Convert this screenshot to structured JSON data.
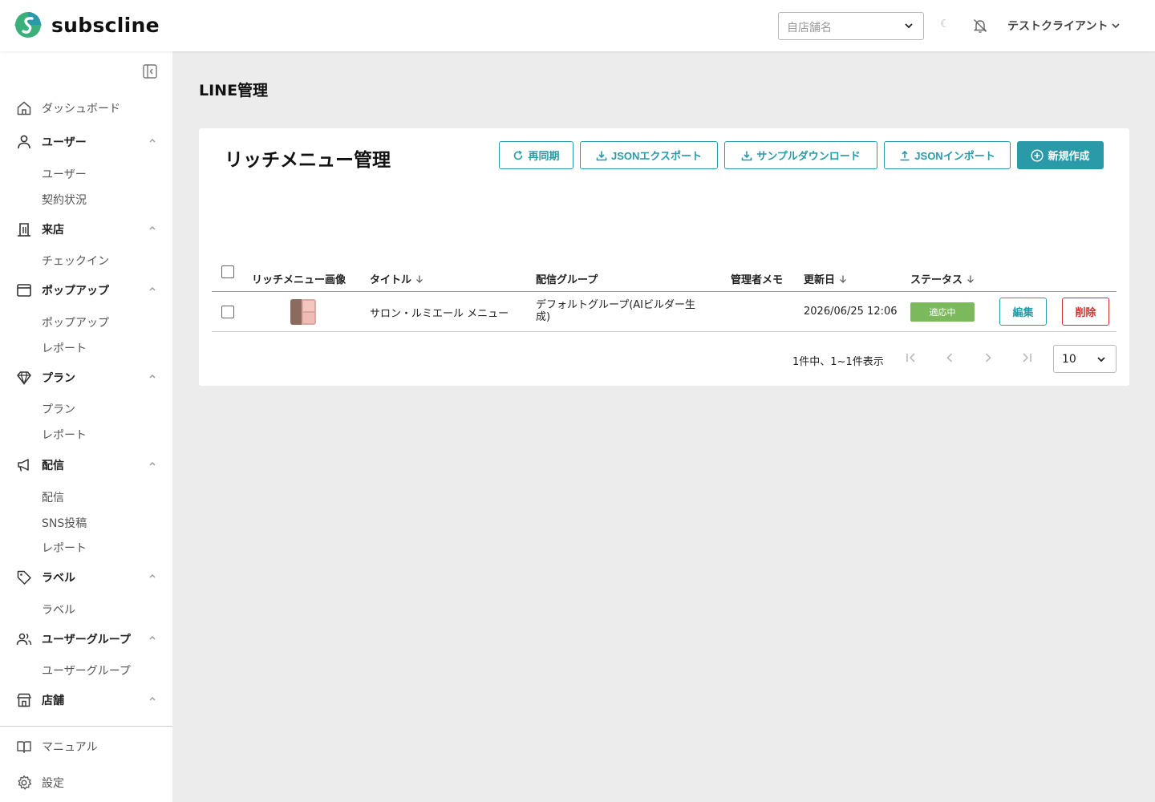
{
  "app": {
    "brand": "subscline",
    "colors": {
      "accent": "#2a9aa8",
      "danger": "#d0302c",
      "status_active": "#7cb95c",
      "logo_green": "#3ab07a",
      "logo_teal": "#2a9aa8"
    }
  },
  "header": {
    "store_placeholder": "自店舗名",
    "theme_icon": "☾",
    "user_name": "テストクライアント"
  },
  "sidebar": {
    "groups": [
      {
        "label": "ダッシュボード",
        "icon": "home-icon",
        "items": []
      },
      {
        "label": "ユーザー",
        "icon": "user-icon",
        "items": [
          "ユーザー",
          "契約状況"
        ]
      },
      {
        "label": "来店",
        "icon": "building-icon",
        "items": [
          "チェックイン"
        ]
      },
      {
        "label": "ポップアップ",
        "icon": "window-icon",
        "items": [
          "ポップアップ",
          "レポート"
        ]
      },
      {
        "label": "プラン",
        "icon": "diamond-icon",
        "items": [
          "プラン",
          "レポート"
        ]
      },
      {
        "label": "配信",
        "icon": "megaphone-icon",
        "items": [
          "配信",
          "SNS投稿",
          "レポート"
        ]
      },
      {
        "label": "ラベル",
        "icon": "tag-icon",
        "items": [
          "ラベル"
        ]
      },
      {
        "label": "ユーザーグループ",
        "icon": "users-icon",
        "items": [
          "ユーザーグループ"
        ]
      },
      {
        "label": "店舗",
        "icon": "store-icon",
        "items": []
      }
    ],
    "footer": [
      {
        "label": "マニュアル",
        "icon": "book-icon"
      },
      {
        "label": "設定",
        "icon": "gear-icon"
      }
    ]
  },
  "page": {
    "title": "LINE管理",
    "card_title": "リッチメニュー管理",
    "actions": {
      "resync": "再同期",
      "export": "JSONエクスポート",
      "sample": "サンプルダウンロード",
      "import": "JSONインポート",
      "create": "新規作成"
    },
    "table": {
      "columns": {
        "image": "リッチメニュー画像",
        "title": "タイトル",
        "group": "配信グループ",
        "memo": "管理者メモ",
        "updated": "更新日",
        "status": "ステータス"
      },
      "rows": [
        {
          "title": "サロン・ルミエール メニュー",
          "group_line1": "デフォルトグループ(AIビルダー生",
          "group_line2": "成)",
          "memo": "",
          "updated": "2026/06/25 12:06",
          "status": "適応中",
          "edit": "編集",
          "delete": "削除"
        }
      ]
    },
    "pagination": {
      "summary": "1件中、1~1件表示",
      "per_page": "10"
    }
  }
}
